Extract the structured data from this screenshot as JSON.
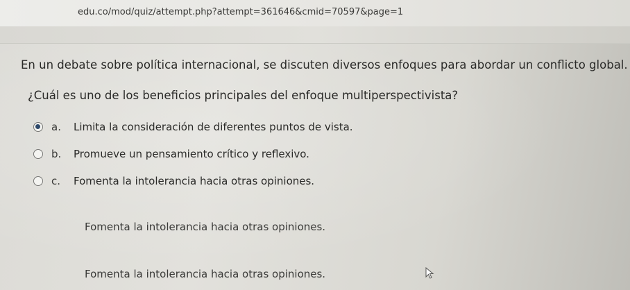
{
  "browser": {
    "url": "edu.co/mod/quiz/attempt.php?attempt=361646&cmid=70597&page=1"
  },
  "question": {
    "text": "En un debate sobre política internacional, se discuten diversos enfoques para abordar un conflicto global.",
    "prompt": "¿Cuál es uno de los beneficios principales del enfoque multiperspectivista?",
    "options": [
      {
        "letter": "a.",
        "text": "Limita la consideración de diferentes puntos de vista.",
        "selected": true
      },
      {
        "letter": "b.",
        "text": "Promueve un pensamiento crítico y reflexivo.",
        "selected": false
      },
      {
        "letter": "c.",
        "text": "Fomenta la intolerancia hacia otras opiniones.",
        "selected": false
      }
    ]
  },
  "repeated_text": [
    "Fomenta la intolerancia hacia otras opiniones.",
    "Fomenta la intolerancia hacia otras opiniones."
  ],
  "colors": {
    "radio_selected": "#2f4a6b",
    "text": "#2a2a28"
  },
  "icons": [
    "cursor-icon"
  ]
}
